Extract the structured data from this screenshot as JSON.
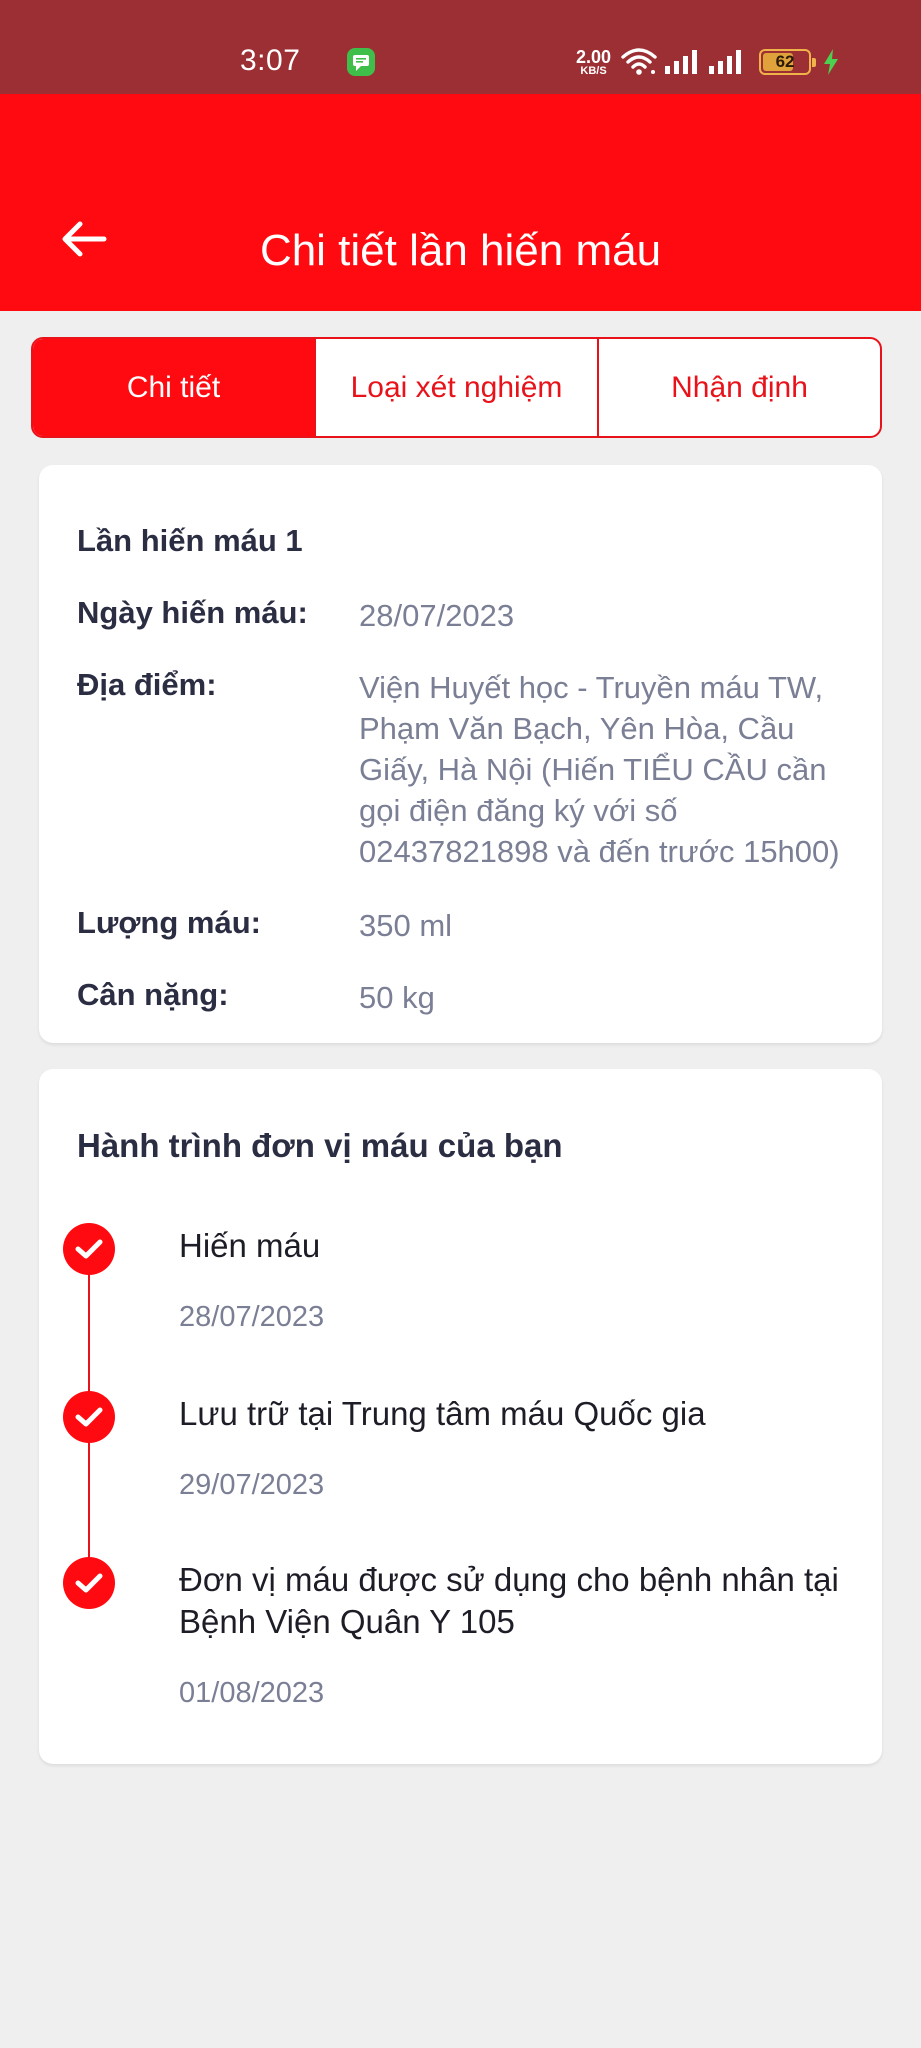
{
  "status_bar": {
    "time": "3:07",
    "net_speed": "2.00",
    "net_unit": "KB/S",
    "battery": "62",
    "icons": [
      "messages-icon",
      "wifi-icon",
      "signal-icon",
      "signal-icon",
      "battery-icon",
      "charging-icon"
    ]
  },
  "header": {
    "title": "Chi tiết lần hiến máu",
    "back_icon": "arrow-left-icon"
  },
  "tabs": [
    {
      "label": "Chi tiết",
      "active": true
    },
    {
      "label": "Loại xét nghiệm",
      "active": false
    },
    {
      "label": "Nhận định",
      "active": false
    }
  ],
  "details": {
    "title": "Lần hiến máu 1",
    "rows": [
      {
        "label": "Ngày hiến máu:",
        "value": "28/07/2023"
      },
      {
        "label": "Địa điểm:",
        "value": "Viện Huyết học - Truyền máu TW, Phạm Văn Bạch, Yên Hòa, Cầu Giấy, Hà Nội (Hiến TIỂU CẦU cần gọi điện đăng ký với số 02437821898 và đến trước 15h00)"
      },
      {
        "label": "Lượng máu:",
        "value": "350 ml"
      },
      {
        "label": "Cân nặng:",
        "value": "50 kg"
      }
    ]
  },
  "journey": {
    "title": "Hành trình đơn vị máu của bạn",
    "steps": [
      {
        "label": "Hiến máu",
        "date": "28/07/2023"
      },
      {
        "label": "Lưu trữ tại Trung tâm máu Quốc gia",
        "date": "29/07/2023"
      },
      {
        "label": "Đơn vị máu được sử dụng cho bệnh nhân tại Bệnh Viện Quân Y 105",
        "date": "01/08/2023"
      }
    ]
  },
  "colors": {
    "brand_red": "#ff0a10",
    "status_bar": "#9c2f33",
    "background": "#efefef",
    "muted_text": "#7b7f95"
  }
}
